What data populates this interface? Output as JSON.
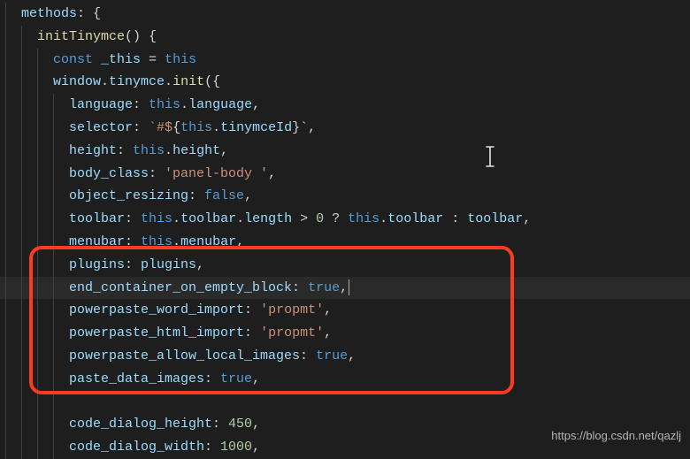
{
  "code": {
    "l1": {
      "prop": "methods",
      "punc": ": {"
    },
    "l2": {
      "func": "initTinymce",
      "punc": "() {"
    },
    "l3": {
      "kw": "const",
      "var": "_this",
      "op": " = ",
      "this": "this"
    },
    "l4": {
      "obj": "window",
      "dot1": ".",
      "m1": "tinymce",
      "dot2": ".",
      "func": "init",
      "open": "({"
    },
    "l5": {
      "prop": "language",
      "colon": ": ",
      "this": "this",
      "dot": ".",
      "m": "language",
      "comma": ","
    },
    "l6": {
      "prop": "selector",
      "colon": ": ",
      "tpl_open": "`",
      "tpl_text": "#$",
      "tpl_brace": "{",
      "this": "this",
      "dot": ".",
      "m": "tinymceId",
      "tpl_close": "}`",
      "comma": ","
    },
    "l7": {
      "prop": "height",
      "colon": ": ",
      "this": "this",
      "dot": ".",
      "m": "height",
      "comma": ","
    },
    "l8": {
      "prop": "body_class",
      "colon": ": ",
      "str": "'panel-body '",
      "comma": ","
    },
    "l9": {
      "prop": "object_resizing",
      "colon": ": ",
      "bool": "false",
      "comma": ","
    },
    "l10": {
      "prop": "toolbar",
      "colon": ": ",
      "this": "this",
      "dot": ".",
      "m1": "toolbar",
      "dot2": ".",
      "m2": "length",
      "op": " > ",
      "num": "0",
      "tern": " ? ",
      "this2": "this",
      "dot3": ".",
      "m3": "toolbar",
      "tern2": " : ",
      "m4": "toolbar",
      "comma": ","
    },
    "l11": {
      "prop": "menubar",
      "colon": ": ",
      "this": "this",
      "dot": ".",
      "m": "menubar",
      "comma": ","
    },
    "l12": {
      "prop": "plugins",
      "colon": ": ",
      "m": "plugins",
      "comma": ","
    },
    "l13": {
      "prop": "end_container_on_empty_block",
      "colon": ": ",
      "bool": "true",
      "comma": ","
    },
    "l14": {
      "prop": "powerpaste_word_import",
      "colon": ": ",
      "str": "'propmt'",
      "comma": ","
    },
    "l15": {
      "prop": "powerpaste_html_import",
      "colon": ": ",
      "str": "'propmt'",
      "comma": ","
    },
    "l16": {
      "prop": "powerpaste_allow_local_images",
      "colon": ": ",
      "bool": "true",
      "comma": ","
    },
    "l17": {
      "prop": "paste_data_images",
      "colon": ": ",
      "bool": "true",
      "comma": ","
    },
    "l18": {
      "blank": ""
    },
    "l19": {
      "prop": "code_dialog_height",
      "colon": ": ",
      "num": "450",
      "comma": ","
    },
    "l20": {
      "prop": "code_dialog_width",
      "colon": ": ",
      "num": "1000",
      "comma": ","
    }
  },
  "watermark": "https://blog.csdn.net/qazlj"
}
